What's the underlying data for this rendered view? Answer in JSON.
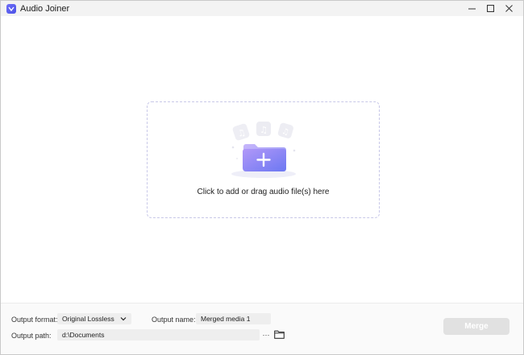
{
  "window": {
    "title": "Audio Joiner",
    "controls": {
      "minimize": "—",
      "maximize": "☐",
      "close": "✕"
    }
  },
  "dropzone": {
    "label": "Click to add or drag audio file(s) here",
    "icons": [
      "music-note-card-icon",
      "folder-add-icon"
    ]
  },
  "bottom": {
    "output_format_label": "Output format:",
    "output_format_value": "Original Lossless",
    "output_name_label": "Output name:",
    "output_name_value": "Merged media 1",
    "output_path_label": "Output path:",
    "output_path_value": "d:\\Documents",
    "more_label": "···",
    "merge_label": "Merge"
  },
  "colors": {
    "accent": "#7b7ff3",
    "folder_gradient_start": "#b198f8",
    "folder_gradient_end": "#6c78f2",
    "merge_disabled": "#e1e1e1"
  }
}
